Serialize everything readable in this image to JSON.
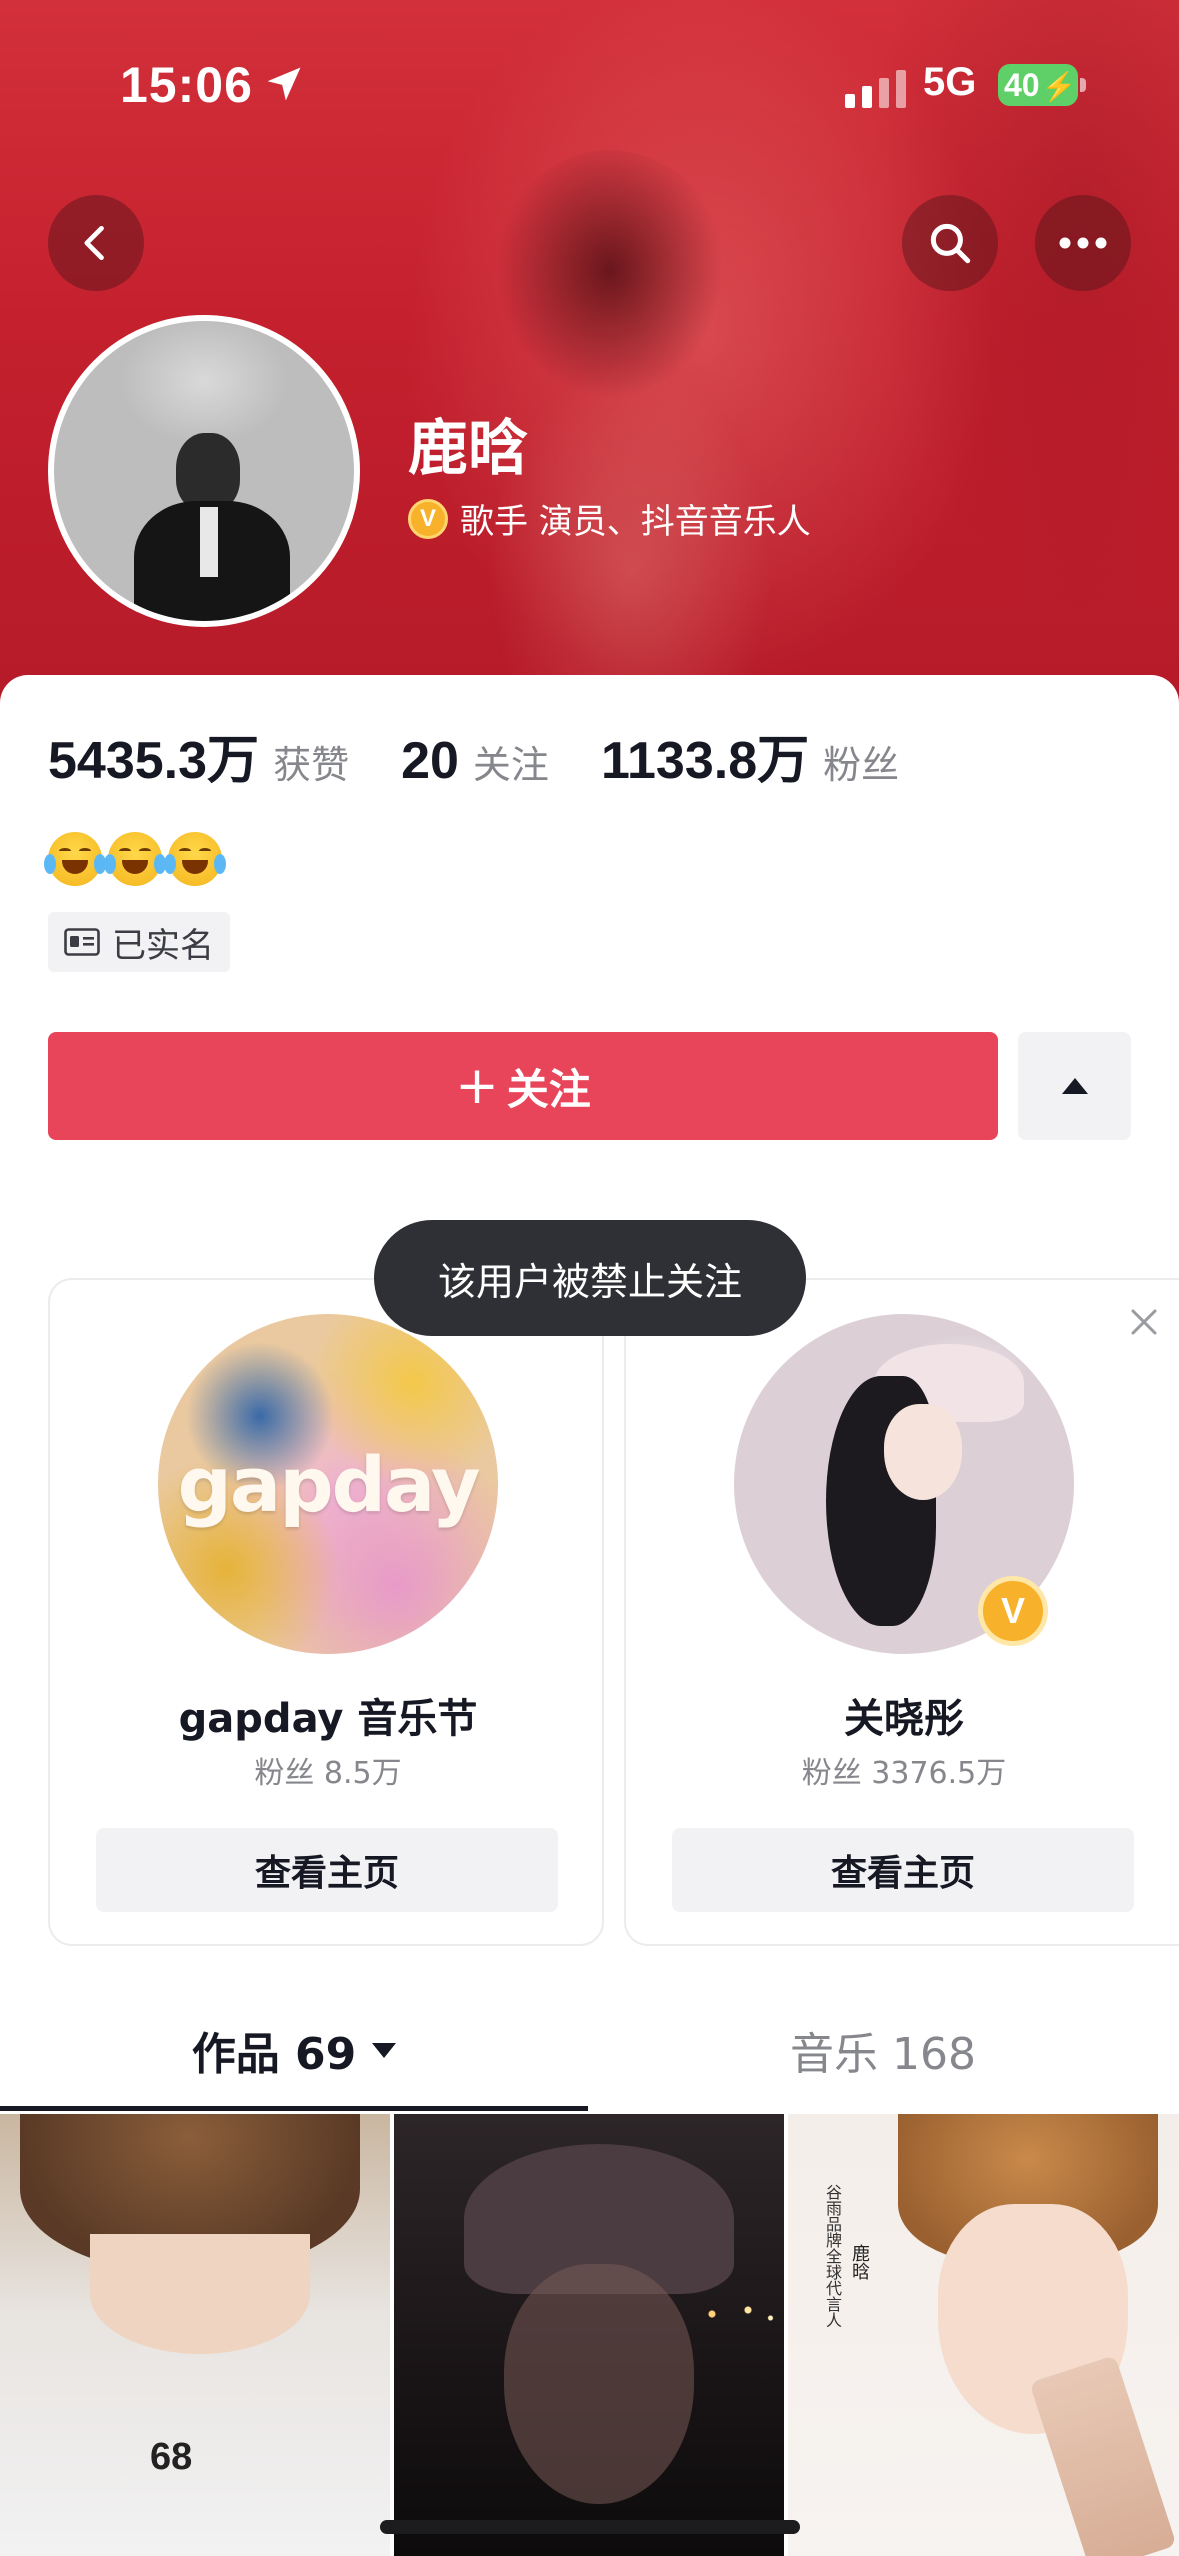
{
  "status_bar": {
    "time": "15:06",
    "network": "5G",
    "battery": "40"
  },
  "profile": {
    "name": "鹿晗",
    "verification": "歌手 演员、抖音音乐人",
    "verify_badge": "V",
    "stats": [
      {
        "value": "5435.3万",
        "label": "获赞"
      },
      {
        "value": "20",
        "label": "关注"
      },
      {
        "value": "1133.8万",
        "label": "粉丝"
      }
    ],
    "bio_emojis": [
      "laughing-tears-emoji",
      "laughing-tears-emoji",
      "laughing-tears-emoji"
    ],
    "realname_tag": "已实名"
  },
  "actions": {
    "follow_label": "关注",
    "follow_plus": "+"
  },
  "toast": "该用户被禁止关注",
  "recommendations": [
    {
      "name": "gapday 音乐节",
      "fans": "粉丝 8.5万",
      "button": "查看主页",
      "avatar_text": "gapday"
    },
    {
      "name": "关晓彤",
      "fans": "粉丝 3376.5万",
      "button": "查看主页",
      "badge": "V"
    }
  ],
  "tabs": [
    {
      "label": "作品 69",
      "active": true
    },
    {
      "label": "音乐 168",
      "active": false
    }
  ],
  "videos": [
    {
      "overlay": "68"
    },
    {
      "overlay": ""
    },
    {
      "caption": "谷雨品牌全球代言人",
      "name": "鹿晗"
    }
  ],
  "colors": {
    "header_red": "#c4202e",
    "follow_button": "#e8455a",
    "verify_gold": "#f7b12b",
    "battery_green": "#5fd068"
  },
  "icons": {
    "back": "chevron-left-icon",
    "search": "search-icon",
    "more": "more-horizontal-icon",
    "location": "location-arrow-icon",
    "close": "close-icon",
    "id_card": "id-card-icon",
    "expand": "triangle-up-icon",
    "tab_caret": "triangle-down-icon"
  }
}
